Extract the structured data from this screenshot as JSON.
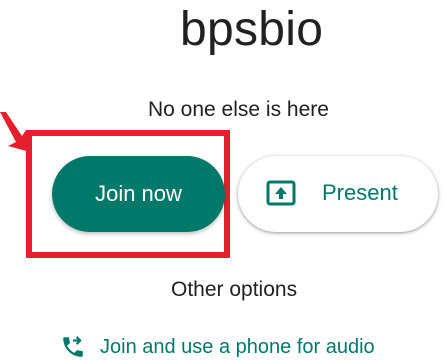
{
  "meeting": {
    "title": "bpsbio",
    "status": "No one else is here"
  },
  "actions": {
    "join_label": "Join now",
    "present_label": "Present",
    "other_options_label": "Other options",
    "phone_audio_label": "Join and use a phone for audio"
  },
  "icons": {
    "present": "present-screen-icon",
    "phone": "phone-forwarded-icon",
    "arrow": "red-arrow-icon"
  },
  "colors": {
    "accent": "#00796b",
    "highlight": "#e5202e",
    "text": "#202124"
  }
}
